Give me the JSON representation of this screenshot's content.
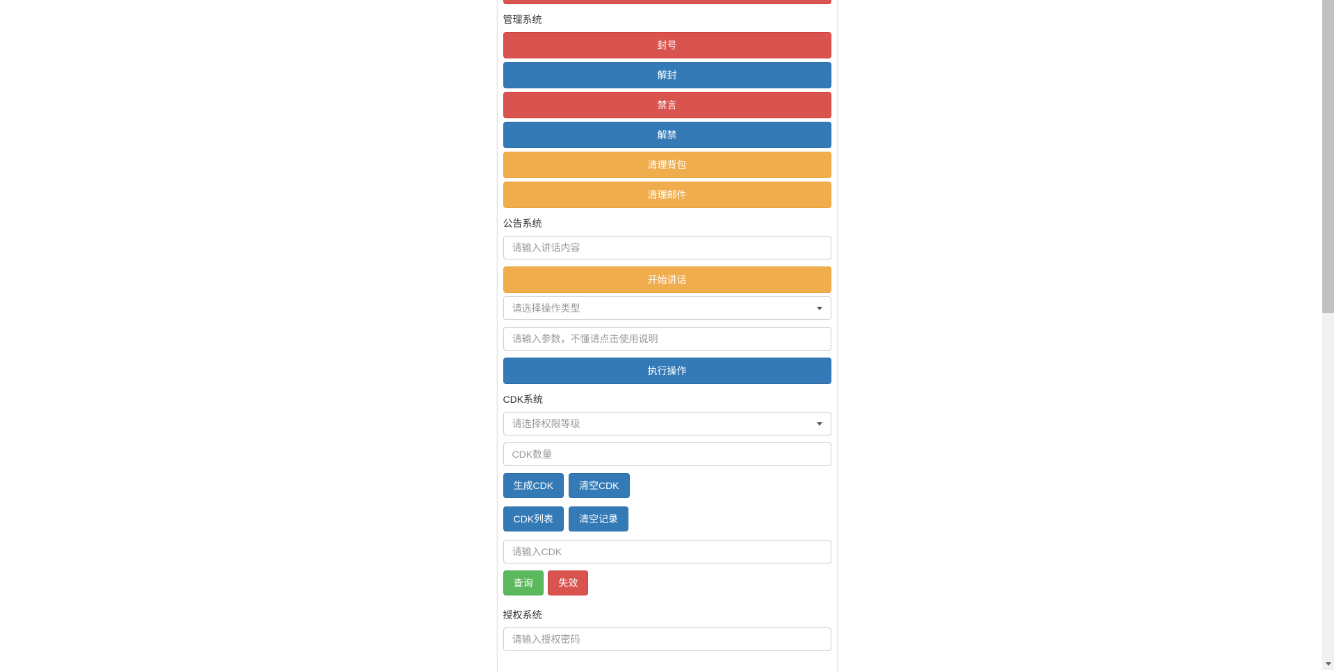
{
  "management_system": {
    "label": "管理系统",
    "buttons": {
      "ban_account": "封号",
      "unban_account": "解封",
      "mute": "禁言",
      "unmute": "解禁",
      "clear_bag": "清理背包",
      "clear_mail": "清理邮件"
    }
  },
  "announce_system": {
    "label": "公告系统",
    "speak_placeholder": "请输入讲话内容",
    "start_speak_btn": "开始讲话",
    "op_type_placeholder": "请选择操作类型",
    "param_placeholder": "请输入参数，不懂请点击使用说明",
    "execute_btn": "执行操作"
  },
  "cdk_system": {
    "label": "CDK系统",
    "perm_placeholder": "请选择权限等级",
    "count_placeholder": "CDK数量",
    "gen_btn": "生成CDK",
    "clear_btn": "清空CDK",
    "list_btn": "CDK列表",
    "clear_log_btn": "清空记录",
    "cdk_input_placeholder": "请输入CDK",
    "query_btn": "查询",
    "invalid_btn": "失效"
  },
  "auth_system": {
    "label": "授权系统",
    "auth_pwd_placeholder": "请输入授权密码"
  }
}
